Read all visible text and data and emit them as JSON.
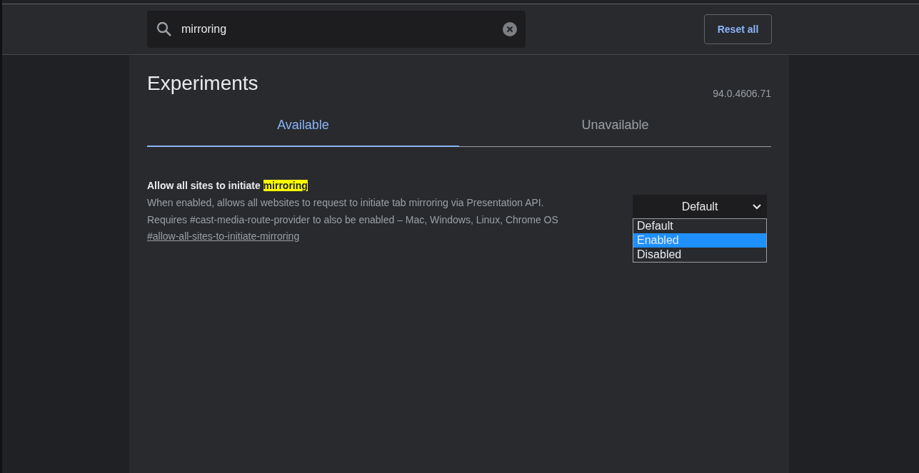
{
  "search": {
    "value": "mirroring"
  },
  "reset_button": "Reset all",
  "title": "Experiments",
  "version": "94.0.4606.71",
  "tabs": [
    {
      "label": "Available",
      "selected": true
    },
    {
      "label": "Unavailable",
      "selected": false
    }
  ],
  "experiments": [
    {
      "title": "Allow all sites to initiate",
      "match": "mirroring",
      "description": "When enabled, allows all websites to request to initiate tab mirroring via Presentation API. Requires #cast-media-route-provider to also be enabled – Mac, Windows, Linux, Chrome OS",
      "link": "#allow-all-sites-to-initiate-mirroring",
      "dropdown": {
        "value": "Default",
        "options": [
          {
            "label": "Default",
            "highlighted": false
          },
          {
            "label": "Enabled",
            "highlighted": true
          },
          {
            "label": "Disabled",
            "highlighted": false
          }
        ]
      }
    }
  ]
}
